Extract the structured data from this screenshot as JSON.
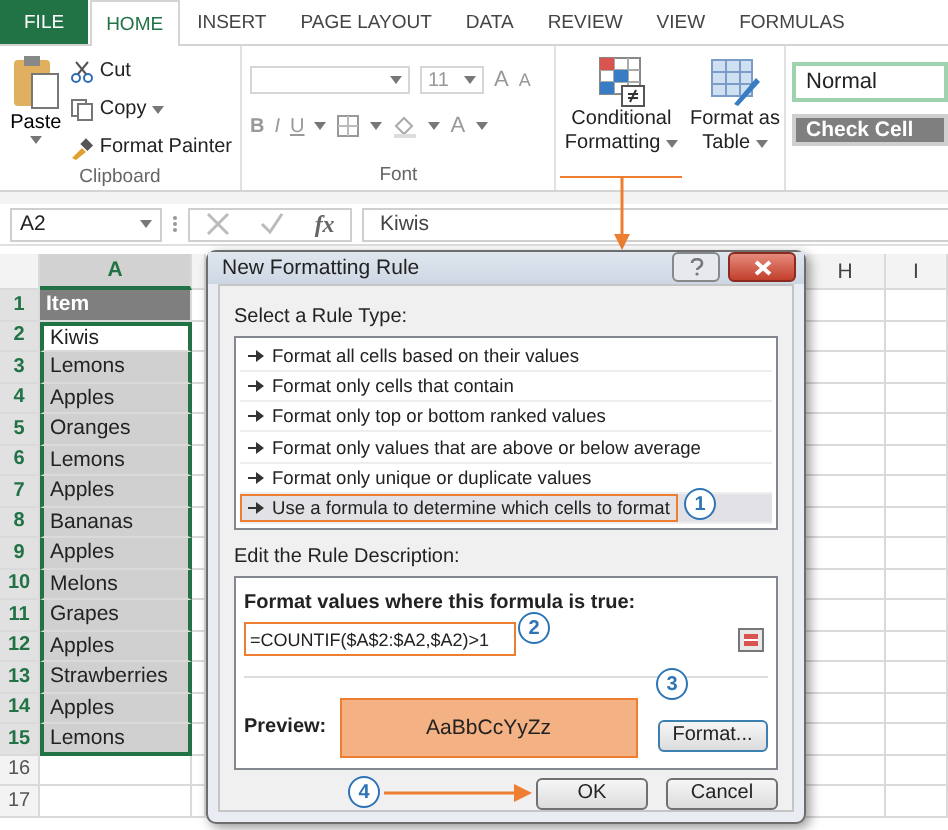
{
  "tabs": [
    {
      "label": "FILE",
      "kind": "file",
      "selected": false
    },
    {
      "label": "HOME",
      "kind": "tab",
      "selected": true
    },
    {
      "label": "INSERT",
      "kind": "tab",
      "selected": false
    },
    {
      "label": "PAGE LAYOUT",
      "kind": "tab",
      "selected": false
    },
    {
      "label": "DATA",
      "kind": "tab",
      "selected": false
    },
    {
      "label": "REVIEW",
      "kind": "tab",
      "selected": false
    },
    {
      "label": "VIEW",
      "kind": "tab",
      "selected": false
    },
    {
      "label": "FORMULAS",
      "kind": "tab",
      "selected": false
    }
  ],
  "clipboard": {
    "paste": "Paste",
    "cut": "Cut",
    "copy": "Copy",
    "format_painter": "Format Painter",
    "label": "Clipboard"
  },
  "font": {
    "size": "11",
    "grow": "A",
    "shrink": "A",
    "bold": "B",
    "italic": "I",
    "underline": "U",
    "font_color": "A",
    "label": "Font"
  },
  "conditional_formatting": {
    "line1": "Conditional",
    "line2": "Formatting",
    "highlighted": true
  },
  "format_as_table": {
    "line1": "Format as",
    "line2": "Table"
  },
  "styles": [
    {
      "label": "Normal",
      "kind": "normal"
    },
    {
      "label": "Check Cell",
      "kind": "check"
    }
  ],
  "formula_bar": {
    "name_box": "A2",
    "fx": "fx",
    "value": "Kiwis"
  },
  "sheet": {
    "columns": [
      {
        "label": "A",
        "selected": true
      },
      {
        "label": "H",
        "selected": false
      },
      {
        "label": "I",
        "selected": false
      }
    ],
    "rows": [
      {
        "number": "1",
        "value": "Item",
        "kind": "header",
        "selected": true,
        "active": false
      },
      {
        "number": "2",
        "value": "Kiwis",
        "kind": "cell",
        "selected": true,
        "active": true
      },
      {
        "number": "3",
        "value": "Lemons",
        "kind": "cell",
        "selected": true,
        "active": false
      },
      {
        "number": "4",
        "value": "Apples",
        "kind": "cell",
        "selected": true,
        "active": false
      },
      {
        "number": "5",
        "value": "Oranges",
        "kind": "cell",
        "selected": true,
        "active": false
      },
      {
        "number": "6",
        "value": "Lemons",
        "kind": "cell",
        "selected": true,
        "active": false
      },
      {
        "number": "7",
        "value": "Apples",
        "kind": "cell",
        "selected": true,
        "active": false
      },
      {
        "number": "8",
        "value": "Bananas",
        "kind": "cell",
        "selected": true,
        "active": false
      },
      {
        "number": "9",
        "value": "Apples",
        "kind": "cell",
        "selected": true,
        "active": false
      },
      {
        "number": "10",
        "value": "Melons",
        "kind": "cell",
        "selected": true,
        "active": false
      },
      {
        "number": "11",
        "value": "Grapes",
        "kind": "cell",
        "selected": true,
        "active": false
      },
      {
        "number": "12",
        "value": "Apples",
        "kind": "cell",
        "selected": true,
        "active": false
      },
      {
        "number": "13",
        "value": "Strawberries",
        "kind": "cell",
        "selected": true,
        "active": false
      },
      {
        "number": "14",
        "value": "Apples",
        "kind": "cell",
        "selected": true,
        "active": false
      },
      {
        "number": "15",
        "value": "Lemons",
        "kind": "cell",
        "selected": true,
        "active": false
      },
      {
        "number": "16",
        "value": "",
        "kind": "cell",
        "selected": false,
        "active": false
      },
      {
        "number": "17",
        "value": "",
        "kind": "cell",
        "selected": false,
        "active": false
      }
    ]
  },
  "dialog": {
    "title": "New Formatting Rule",
    "select_label": "Select a Rule Type:",
    "rule_types": [
      {
        "label": "Format all cells based on their values",
        "selected": false,
        "highlighted": false
      },
      {
        "label": "Format only cells that contain",
        "selected": false,
        "highlighted": false
      },
      {
        "label": "Format only top or bottom ranked values",
        "selected": false,
        "highlighted": false
      },
      {
        "label": "Format only values that are above or below average",
        "selected": false,
        "highlighted": false
      },
      {
        "label": "Format only unique or duplicate values",
        "selected": false,
        "highlighted": false
      },
      {
        "label": "Use a formula to determine which cells to format",
        "selected": true,
        "highlighted": true
      }
    ],
    "edit_label": "Edit the Rule Description:",
    "formula_label": "Format values where this formula is true:",
    "formula": "=COUNTIF($A$2:$A2,$A2)>1",
    "preview_label": "Preview:",
    "preview_sample": "AaBbCcYyZz",
    "format_button": "Format...",
    "ok": "OK",
    "cancel": "Cancel"
  },
  "callouts": [
    "1",
    "2",
    "3",
    "4"
  ]
}
